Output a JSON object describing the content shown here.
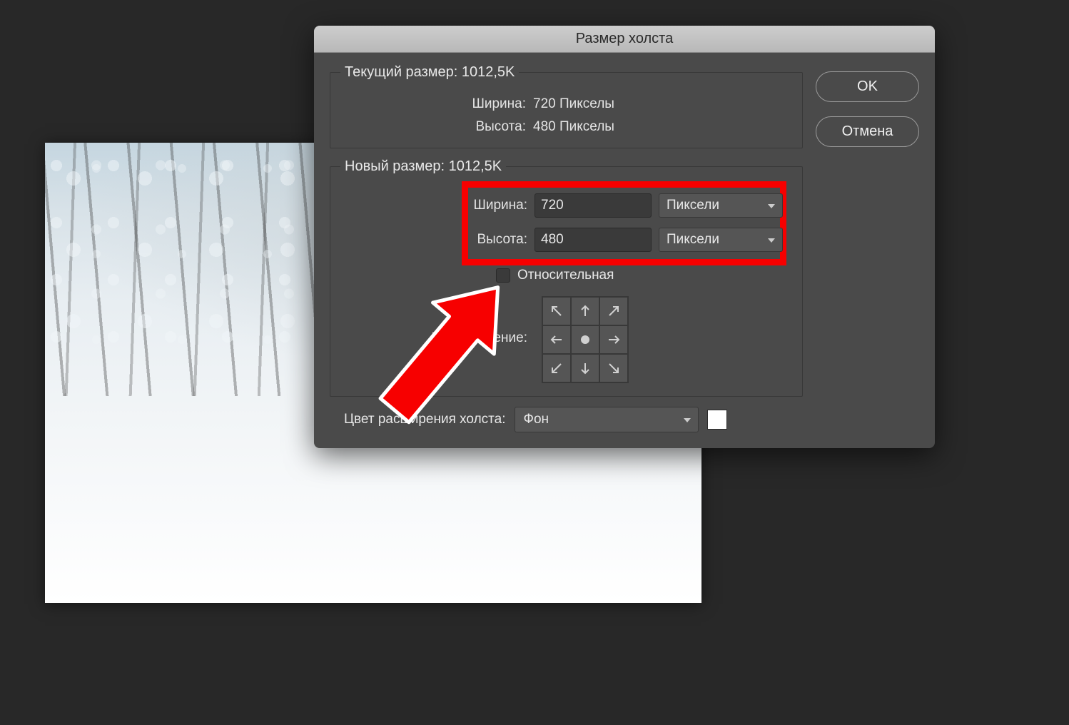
{
  "dialog": {
    "title": "Размер холста",
    "ok_label": "OK",
    "cancel_label": "Отмена",
    "current_size": {
      "legend": "Текущий размер:  1012,5K",
      "width_label": "Ширина:",
      "width_value": "720 Пикселы",
      "height_label": "Высота:",
      "height_value": "480 Пикселы"
    },
    "new_size": {
      "legend": "Новый размер: 1012,5K",
      "width_label": "Ширина:",
      "width_value": "720",
      "width_unit": "Пиксели",
      "height_label": "Высота:",
      "height_value": "480",
      "height_unit": "Пиксели",
      "relative_label": "Относительная",
      "anchor_label": "Расположение:"
    },
    "extension_color_label": "Цвет расширения холста:",
    "extension_color_value": "Фон",
    "extension_color_swatch": "#ffffff"
  }
}
